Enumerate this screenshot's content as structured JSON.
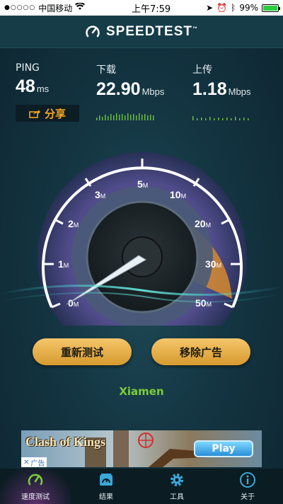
{
  "status_bar": {
    "signal": "●○○○○",
    "carrier": "中国移动",
    "wifi_icon": "wifi-icon",
    "time": "上午7:59",
    "battery": "99%",
    "battery_level": 0.99
  },
  "header": {
    "title": "SPEEDTEST",
    "trademark": "™"
  },
  "stats": {
    "ping": {
      "label": "PING",
      "value": "48",
      "unit": "ms"
    },
    "download": {
      "label": "下载",
      "value": "22.90",
      "unit": "Mbps"
    },
    "upload": {
      "label": "上传",
      "value": "1.18",
      "unit": "Mbps"
    },
    "share_label": "分享"
  },
  "gauge": {
    "tick_labels": [
      "0",
      "1",
      "2",
      "3",
      "5",
      "10",
      "20",
      "30",
      "50"
    ],
    "tick_unit": "M",
    "needle_value": "0"
  },
  "buttons": {
    "retest": "重新测试",
    "remove_ads": "移除广告"
  },
  "location": "Xiamen",
  "ad": {
    "title": "Clash of Kings",
    "tag": "广告",
    "play": "Play"
  },
  "tabs": [
    {
      "label": "速度测试",
      "icon": "speedometer-icon"
    },
    {
      "label": "结果",
      "icon": "results-icon"
    },
    {
      "label": "工具",
      "icon": "gear-icon"
    },
    {
      "label": "关于",
      "icon": "info-icon"
    }
  ],
  "colors": {
    "accent_orange": "#f5a623",
    "gauge_blue": "#3d5a9c",
    "city_green": "#7ccd3b"
  }
}
